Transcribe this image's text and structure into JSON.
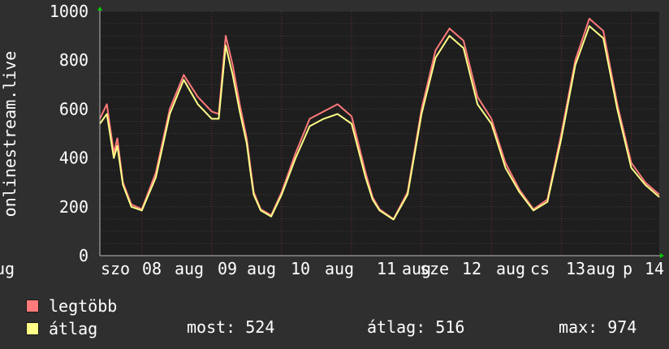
{
  "chart_data": {
    "type": "line",
    "ylabel": "onlinestream.live",
    "ylim": [
      0,
      1000
    ],
    "yticks": [
      0,
      200,
      400,
      600,
      800,
      1000
    ],
    "xtick_labels": [
      "szo",
      "08",
      "aug",
      "09",
      "aug",
      "10",
      "aug",
      "11",
      "aug",
      "sze",
      "12",
      "aug",
      "cs",
      "13",
      "aug",
      "p",
      "14",
      "aug"
    ],
    "grid": true,
    "series": [
      {
        "name": "legtöbb",
        "color": "#ff7a7a",
        "x": [
          0,
          0.1,
          0.2,
          0.25,
          0.33,
          0.45,
          0.6,
          0.8,
          1.0,
          1.2,
          1.4,
          1.6,
          1.7,
          1.8,
          1.9,
          2.0,
          2.1,
          2.15,
          2.2,
          2.3,
          2.45,
          2.6,
          2.8,
          3.0,
          3.2,
          3.4,
          3.6,
          3.8,
          3.9,
          4.0,
          4.2,
          4.4,
          4.6,
          4.8,
          5.0,
          5.2,
          5.4,
          5.6,
          5.8,
          6.0,
          6.2,
          6.4,
          6.6,
          6.8,
          7.0,
          7.2,
          7.4,
          7.6,
          7.8,
          8.0
        ],
        "values": [
          560,
          620,
          420,
          480,
          300,
          210,
          190,
          340,
          600,
          740,
          650,
          590,
          580,
          900,
          780,
          620,
          480,
          370,
          260,
          190,
          165,
          260,
          420,
          560,
          590,
          620,
          570,
          340,
          240,
          190,
          150,
          260,
          600,
          840,
          930,
          880,
          650,
          560,
          380,
          270,
          190,
          230,
          500,
          800,
          970,
          920,
          620,
          380,
          300,
          250
        ]
      },
      {
        "name": "átlag",
        "color": "#ffff88",
        "x": [
          0,
          0.1,
          0.2,
          0.25,
          0.33,
          0.45,
          0.6,
          0.8,
          1.0,
          1.2,
          1.4,
          1.6,
          1.7,
          1.8,
          1.9,
          2.0,
          2.1,
          2.15,
          2.2,
          2.3,
          2.45,
          2.6,
          2.8,
          3.0,
          3.2,
          3.4,
          3.6,
          3.8,
          3.9,
          4.0,
          4.2,
          4.4,
          4.6,
          4.8,
          5.0,
          5.2,
          5.4,
          5.6,
          5.8,
          6.0,
          6.2,
          6.4,
          6.6,
          6.8,
          7.0,
          7.2,
          7.4,
          7.6,
          7.8,
          8.0
        ],
        "values": [
          540,
          580,
          400,
          450,
          290,
          200,
          185,
          320,
          580,
          720,
          620,
          560,
          560,
          860,
          740,
          590,
          460,
          350,
          250,
          185,
          160,
          250,
          400,
          530,
          560,
          580,
          540,
          320,
          230,
          185,
          148,
          250,
          580,
          810,
          900,
          850,
          620,
          540,
          360,
          260,
          185,
          220,
          480,
          780,
          940,
          890,
          600,
          360,
          290,
          240
        ]
      }
    ]
  },
  "legend": {
    "items": [
      {
        "label": "legtöbb",
        "color": "#ff7a7a"
      },
      {
        "label": "átlag",
        "color": "#ffff88"
      }
    ]
  },
  "stats": {
    "most": "most: 524",
    "atlag": "átlag: 516",
    "max": "max: 974"
  },
  "colors": {
    "background": "#2f2f2f",
    "plot_background": "#1e1e1e",
    "grid": "#3c3c3c",
    "vgrid": "#6b3030",
    "axis_arrow": "#00cc00"
  }
}
